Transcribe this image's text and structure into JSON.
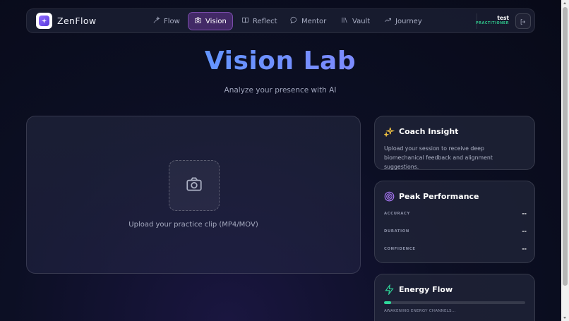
{
  "app": {
    "brand": "ZenFlow",
    "icon": "sparkle-logo-icon"
  },
  "nav": {
    "items": [
      {
        "label": "Flow",
        "icon": "wand-icon",
        "active": false
      },
      {
        "label": "Vision",
        "icon": "camera-icon",
        "active": true
      },
      {
        "label": "Reflect",
        "icon": "book-icon",
        "active": false
      },
      {
        "label": "Mentor",
        "icon": "chat-bubble-icon",
        "active": false
      },
      {
        "label": "Vault",
        "icon": "library-icon",
        "active": false
      },
      {
        "label": "Journey",
        "icon": "trending-up-icon",
        "active": false
      }
    ]
  },
  "user": {
    "name": "test",
    "role": "PRACTITIONER",
    "logout_icon": "logout-icon"
  },
  "header": {
    "title": "Vision Lab",
    "subtitle": "Analyze your presence with AI"
  },
  "upload": {
    "icon": "camera-icon",
    "label": "Upload your practice clip (MP4/MOV)"
  },
  "insight": {
    "title": "Coach Insight",
    "icon": "sparkles-icon",
    "text": "Upload your session to receive deep biomechanical feedback and alignment suggestions."
  },
  "peak": {
    "title": "Peak Performance",
    "icon": "target-icon",
    "metrics": [
      {
        "label": "ACCURACY",
        "value": "--"
      },
      {
        "label": "DURATION",
        "value": "--"
      },
      {
        "label": "CONFIDENCE",
        "value": "--"
      }
    ]
  },
  "energy": {
    "title": "Energy Flow",
    "icon": "lightning-icon",
    "progress": 0.05,
    "status": "AWAKENING ENERGY CHANNELS..."
  },
  "colors": {
    "accent_purple": "#8f6bff",
    "active_tab_border": "#be78ff",
    "title_gradient_start": "#3fa3ff",
    "title_gradient_end": "#9b8dff",
    "role_green": "#2fc58c",
    "energy_green": "#2fd89a",
    "insight_icon": "#f5c542",
    "peak_icon": "#b07cff"
  }
}
